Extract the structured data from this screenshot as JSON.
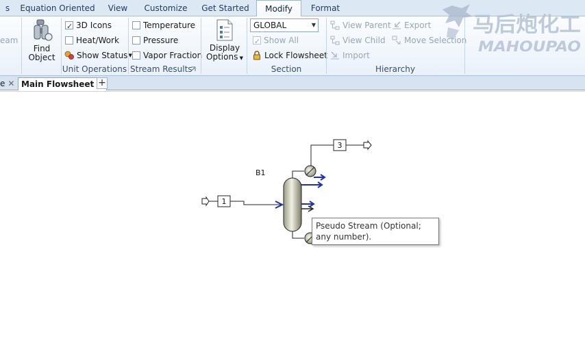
{
  "tabs": [
    {
      "label": "s"
    },
    {
      "label": "Equation Oriented"
    },
    {
      "label": "View"
    },
    {
      "label": "Customize"
    },
    {
      "label": "Get Started"
    },
    {
      "label": "Modify"
    },
    {
      "label": "Format"
    }
  ],
  "ribbon": {
    "cutoff_label": "eam",
    "find_object": {
      "line1": "Find",
      "line2": "Object"
    },
    "unit_operations": {
      "icons3d": "3D Icons",
      "heat_work": "Heat/Work",
      "show_status": "Show Status",
      "label": "Unit Operations"
    },
    "stream_results": {
      "temperature": "Temperature",
      "pressure": "Pressure",
      "vapor_fraction": "Vapor Fraction",
      "label": "Stream Results"
    },
    "display_options": {
      "line1": "Display",
      "line2": "Options"
    },
    "section": {
      "dropdown_value": "GLOBAL",
      "show_all": "Show All",
      "lock_flowsheet": "Lock Flowsheet",
      "label": "Section"
    },
    "hierarchy": {
      "view_parent": "View Parent",
      "view_child": "View Child",
      "import": "Import",
      "export": "Export",
      "move_selection": "Move Selection",
      "label": "Hierarchy"
    }
  },
  "watermark": {
    "cn": "马后炮化工",
    "en": "MAHOUPAO"
  },
  "doc_tabs": {
    "prev": "e",
    "active": "Main Flowsheet"
  },
  "flowsheet": {
    "block_label": "B1",
    "stream_1": "1",
    "stream_3": "3",
    "tooltip": "Pseudo Stream (Optional; any number)."
  },
  "colors": {
    "accent": "#1f2fb0",
    "ribbon_bg": "#e9f1fa",
    "tab_bg": "#dde8f5"
  }
}
